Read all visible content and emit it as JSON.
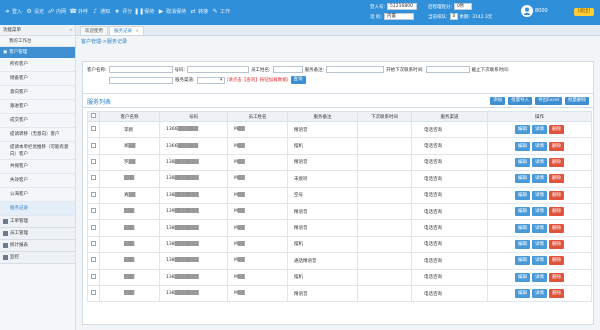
{
  "topbar": {
    "nav": [
      {
        "label": "登入",
        "icon": "login-icon"
      },
      {
        "label": "设定",
        "icon": "settings-icon"
      },
      {
        "label": "内网",
        "icon": "network-icon"
      },
      {
        "label": "外呼",
        "icon": "phone-icon"
      },
      {
        "label": "通知",
        "icon": "bell-icon"
      },
      {
        "label": "评分",
        "icon": "star-icon"
      },
      {
        "label": "保持",
        "icon": "pause-icon"
      },
      {
        "label": "取消保持",
        "icon": "resume-icon"
      },
      {
        "label": "转接",
        "icon": "transfer-icon"
      },
      {
        "label": "工作",
        "icon": "work-icon"
      }
    ],
    "info": {
      "agent_label": "登入号:",
      "agent_value": "51216800",
      "status_label": "后程理程分:",
      "status_value": "0秒",
      "state_label": "话 机:",
      "state_value": "内置",
      "queue_label": "当前排队:",
      "queue_value": "0",
      "balance_label": "余额:",
      "balance_value": "3142.3元"
    },
    "user_name": "8000",
    "exit_label": "[退出]"
  },
  "sidebar": {
    "title": "功能菜单",
    "home_link": "我的工作台",
    "group_label": "客户管理",
    "items": [
      {
        "label": "所有客户",
        "two_line": false,
        "active": false
      },
      {
        "label": "储备客户",
        "two_line": false,
        "active": false
      },
      {
        "label": "意向客户",
        "two_line": false,
        "active": false
      },
      {
        "label": "跟进客户",
        "two_line": false,
        "active": false
      },
      {
        "label": "成交客户",
        "two_line": false,
        "active": false
      },
      {
        "label": "提请转移（无意向）客户",
        "two_line": false,
        "active": false
      },
      {
        "label": "提请本单栏优推移（可能有意向）客户",
        "two_line": true,
        "active": false
      },
      {
        "label": "共保客户",
        "two_line": false,
        "active": false
      },
      {
        "label": "失效客户",
        "two_line": false,
        "active": false
      },
      {
        "label": "公海客户",
        "two_line": false,
        "active": false
      },
      {
        "label": "服务记录",
        "two_line": false,
        "active": true
      }
    ],
    "footer": [
      "工单管理",
      "员工管理",
      "统计报表",
      "监控"
    ]
  },
  "tabs": [
    {
      "label": "欢迎使用",
      "active": false
    },
    {
      "label": "服务记录",
      "active": true
    }
  ],
  "breadcrumb": "客户管理->服务记录",
  "filter": {
    "customer_name_label": "客户名称:",
    "number_label": "号码:",
    "employee_label": "员工姓名:",
    "remark_label": "服务备注:",
    "start_next_label": "开始下次联系时间:",
    "end_next_label": "截止下次联系时间:",
    "channel_label": "服务渠道:",
    "hint": "(请点击【查询】按钮加载数据)",
    "query_button": "查询"
  },
  "list": {
    "title": "服务列表",
    "buttons": [
      "添加",
      "批量导入",
      "导出Excel",
      "批量删除"
    ],
    "columns": [
      "",
      "客户名称",
      "号码",
      "员工姓名",
      "服务备注",
      "下次联系时间",
      "服务渠道",
      "操作"
    ],
    "ops": [
      "编辑",
      "详情",
      "删除"
    ],
    "rows": [
      {
        "name": "李刚",
        "phone": "1366▒▒▒▒▒▒",
        "employee": "M▒▒",
        "remark": "精语音",
        "next": "",
        "channel": "电话咨询"
      },
      {
        "name": "郑▒▒",
        "phone": "1366▒▒▒▒▒▒",
        "employee": "M▒▒",
        "remark": "摆机",
        "next": "",
        "channel": "电话咨询"
      },
      {
        "name": "罗▒▒",
        "phone": "138▒▒▒▒▒▒▒",
        "employee": "M▒▒",
        "remark": "精语音",
        "next": "",
        "channel": "电话咨询"
      },
      {
        "name": "▒▒▒",
        "phone": "138▒▒▒▒▒▒▒",
        "employee": "M▒▒",
        "remark": "未接听",
        "next": "",
        "channel": "电话咨询"
      },
      {
        "name": "真▒▒",
        "phone": "138▒▒▒▒▒▒▒",
        "employee": "M▒▒",
        "remark": "空号",
        "next": "",
        "channel": "电话咨询"
      },
      {
        "name": "▒▒▒",
        "phone": "139▒▒▒▒▒▒▒",
        "employee": "M▒▒",
        "remark": "精语音",
        "next": "",
        "channel": "电话咨询"
      },
      {
        "name": "▒▒▒",
        "phone": "138▒▒▒▒▒▒▒",
        "employee": "M▒▒",
        "remark": "精语音",
        "next": "",
        "channel": "电话咨询"
      },
      {
        "name": "▒▒▒",
        "phone": "138▒▒▒▒▒▒▒",
        "employee": "M▒▒",
        "remark": "摆机",
        "next": "",
        "channel": "电话咨询"
      },
      {
        "name": "▒▒▒",
        "phone": "138▒▒▒▒▒▒▒",
        "employee": "M▒▒",
        "remark": "通話精语音",
        "next": "",
        "channel": "电话咨询"
      },
      {
        "name": "▒▒▒",
        "phone": "138▒▒▒▒▒▒▒",
        "employee": "M▒▒",
        "remark": "摆机",
        "next": "",
        "channel": "电话咨询"
      },
      {
        "name": "▒▒▒",
        "phone": "138▒▒▒▒▒▒▒",
        "employee": "M▒▒",
        "remark": "精语音",
        "next": "",
        "channel": "电话咨询"
      }
    ]
  }
}
